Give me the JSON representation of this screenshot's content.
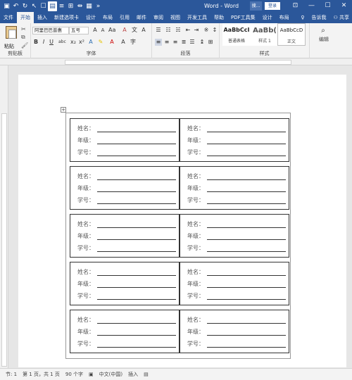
{
  "title_bar": {
    "title": "Word - Word",
    "search_stub": "搜...",
    "login": "登录",
    "quick_access": [
      "save",
      "undo",
      "redo",
      "arrow",
      "touch-mode",
      "layout",
      "indent",
      "table",
      "align",
      "more"
    ]
  },
  "tabs": [
    "文件",
    "开始",
    "插入",
    "新建选项卡",
    "设计",
    "布局",
    "引用",
    "邮件",
    "审阅",
    "视图",
    "开发工具",
    "帮助",
    "PDF工具集",
    "设计",
    "布局"
  ],
  "tab_right": {
    "tell_me": "告诉我",
    "share": "共享"
  },
  "ribbon": {
    "clipboard": {
      "paste": "粘贴",
      "label": "剪贴板"
    },
    "font": {
      "name": "阿里巴巴普惠",
      "size": "五号",
      "label": "字体"
    },
    "paragraph": {
      "label": "段落"
    },
    "styles": {
      "label": "样式",
      "items": [
        {
          "preview": "AaBbCcI",
          "name": "普通表格"
        },
        {
          "preview": "AaBb(",
          "name": "样式 1"
        },
        {
          "preview": "AaBbCcD",
          "name": "正文"
        }
      ]
    },
    "editing": {
      "label": "编辑"
    }
  },
  "form": {
    "name_label": "姓名：",
    "grade_label": "年级：",
    "id_label": "学号：",
    "rows": 5,
    "cols": 2
  },
  "status": {
    "section": "节: 1",
    "page": "第 1 页，共 1 页",
    "words": "90 个字",
    "language": "中文(中国)",
    "mode": "插入"
  }
}
